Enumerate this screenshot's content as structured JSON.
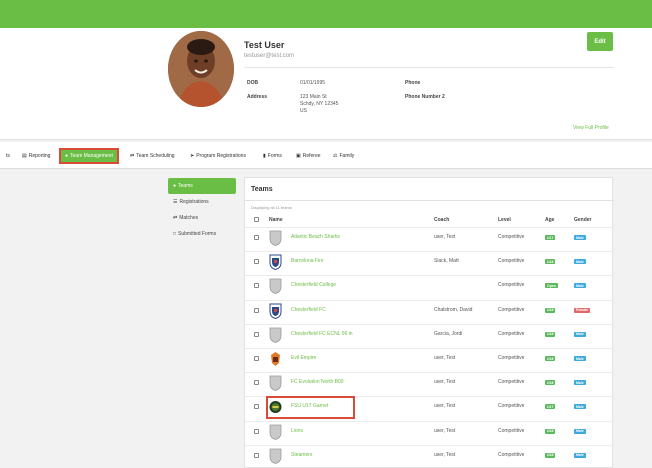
{
  "colors": {
    "brand_green": "#6bbe45",
    "highlight_red": "#d94b35",
    "male_badge": "#3da9de",
    "female_badge": "#e06a6a",
    "age_badge": "#5cb85c"
  },
  "profile": {
    "name": "Test User",
    "email": "testuser@test.com",
    "edit_label": "Edit",
    "dob_label": "DOB",
    "dob_value": "01/01/1995",
    "address_label": "Address",
    "address_lines": [
      "123 Main St",
      "Schdy, NY 12345",
      "US"
    ],
    "phone_label": "Phone",
    "phone2_label": "Phone Number 2",
    "view_full_label": "View Full Profile"
  },
  "nav": {
    "items": [
      {
        "label": "ts",
        "icon": ""
      },
      {
        "label": "Reporting",
        "icon": "document-icon"
      },
      {
        "label": "Team Management",
        "icon": "users-icon",
        "active": true
      },
      {
        "label": "Team Scheduling",
        "icon": "swap-icon"
      },
      {
        "label": "Program Registrations",
        "icon": "send-icon"
      },
      {
        "label": "Forms",
        "icon": "file-icon"
      },
      {
        "label": "Referee",
        "icon": "calendar-icon"
      },
      {
        "label": "Family",
        "icon": "family-icon"
      }
    ]
  },
  "sidebar": {
    "items": [
      {
        "label": "Teams",
        "icon": "users-icon",
        "active": true
      },
      {
        "label": "Registrations",
        "icon": "list-icon"
      },
      {
        "label": "Matches",
        "icon": "swap-icon"
      },
      {
        "label": "Submitted Forms",
        "icon": "file-icon"
      }
    ]
  },
  "teams_panel": {
    "title": "Teams",
    "displaying": "Displaying all 11 teams",
    "headers": {
      "name": "Name",
      "coach": "Coach",
      "level": "Level",
      "age": "Age",
      "gender": "Gender"
    },
    "rows": [
      {
        "name": "Atlantic Beach Sharks",
        "coach": "user, Test",
        "level": "Competitive",
        "age": "U17",
        "gender": "Male",
        "logo": "shield-gray"
      },
      {
        "name": "Barcelona Fire",
        "coach": "Slack, Matt",
        "level": "Competitive",
        "age": "U18",
        "gender": "Male",
        "logo": "shield-blue"
      },
      {
        "name": "Chesterfield College",
        "coach": "",
        "level": "Competitive",
        "age": "Open",
        "gender": "Male",
        "logo": "shield-gray"
      },
      {
        "name": "Chesterfield FC",
        "coach": "Chalstrom, David",
        "level": "Competitive",
        "age": "U18",
        "gender": "Female",
        "logo": "shield-blue"
      },
      {
        "name": "Chesterfield FC ECNL 06 in",
        "coach": "Garcia, Jordi",
        "level": "Competitive",
        "age": "U18",
        "gender": "Male",
        "logo": "shield-gray"
      },
      {
        "name": "Evil Empire",
        "coach": "user, Test",
        "level": "Competitive",
        "age": "U18",
        "gender": "Male",
        "logo": "crest-orange"
      },
      {
        "name": "FC Evolution North B09",
        "coach": "user, Test",
        "level": "Competitive",
        "age": "U18",
        "gender": "Male",
        "logo": "shield-gray"
      },
      {
        "name": "FSU U17 Garnet",
        "coach": "user, Test",
        "level": "Competitive",
        "age": "U17",
        "gender": "Male",
        "logo": "circle-dark"
      },
      {
        "name": "Lions",
        "coach": "user, Test",
        "level": "Competitive",
        "age": "U18",
        "gender": "Male",
        "logo": "shield-gray"
      },
      {
        "name": "Steamers",
        "coach": "user, Test",
        "level": "Competitive",
        "age": "U18",
        "gender": "Male",
        "logo": "shield-gray"
      }
    ]
  }
}
